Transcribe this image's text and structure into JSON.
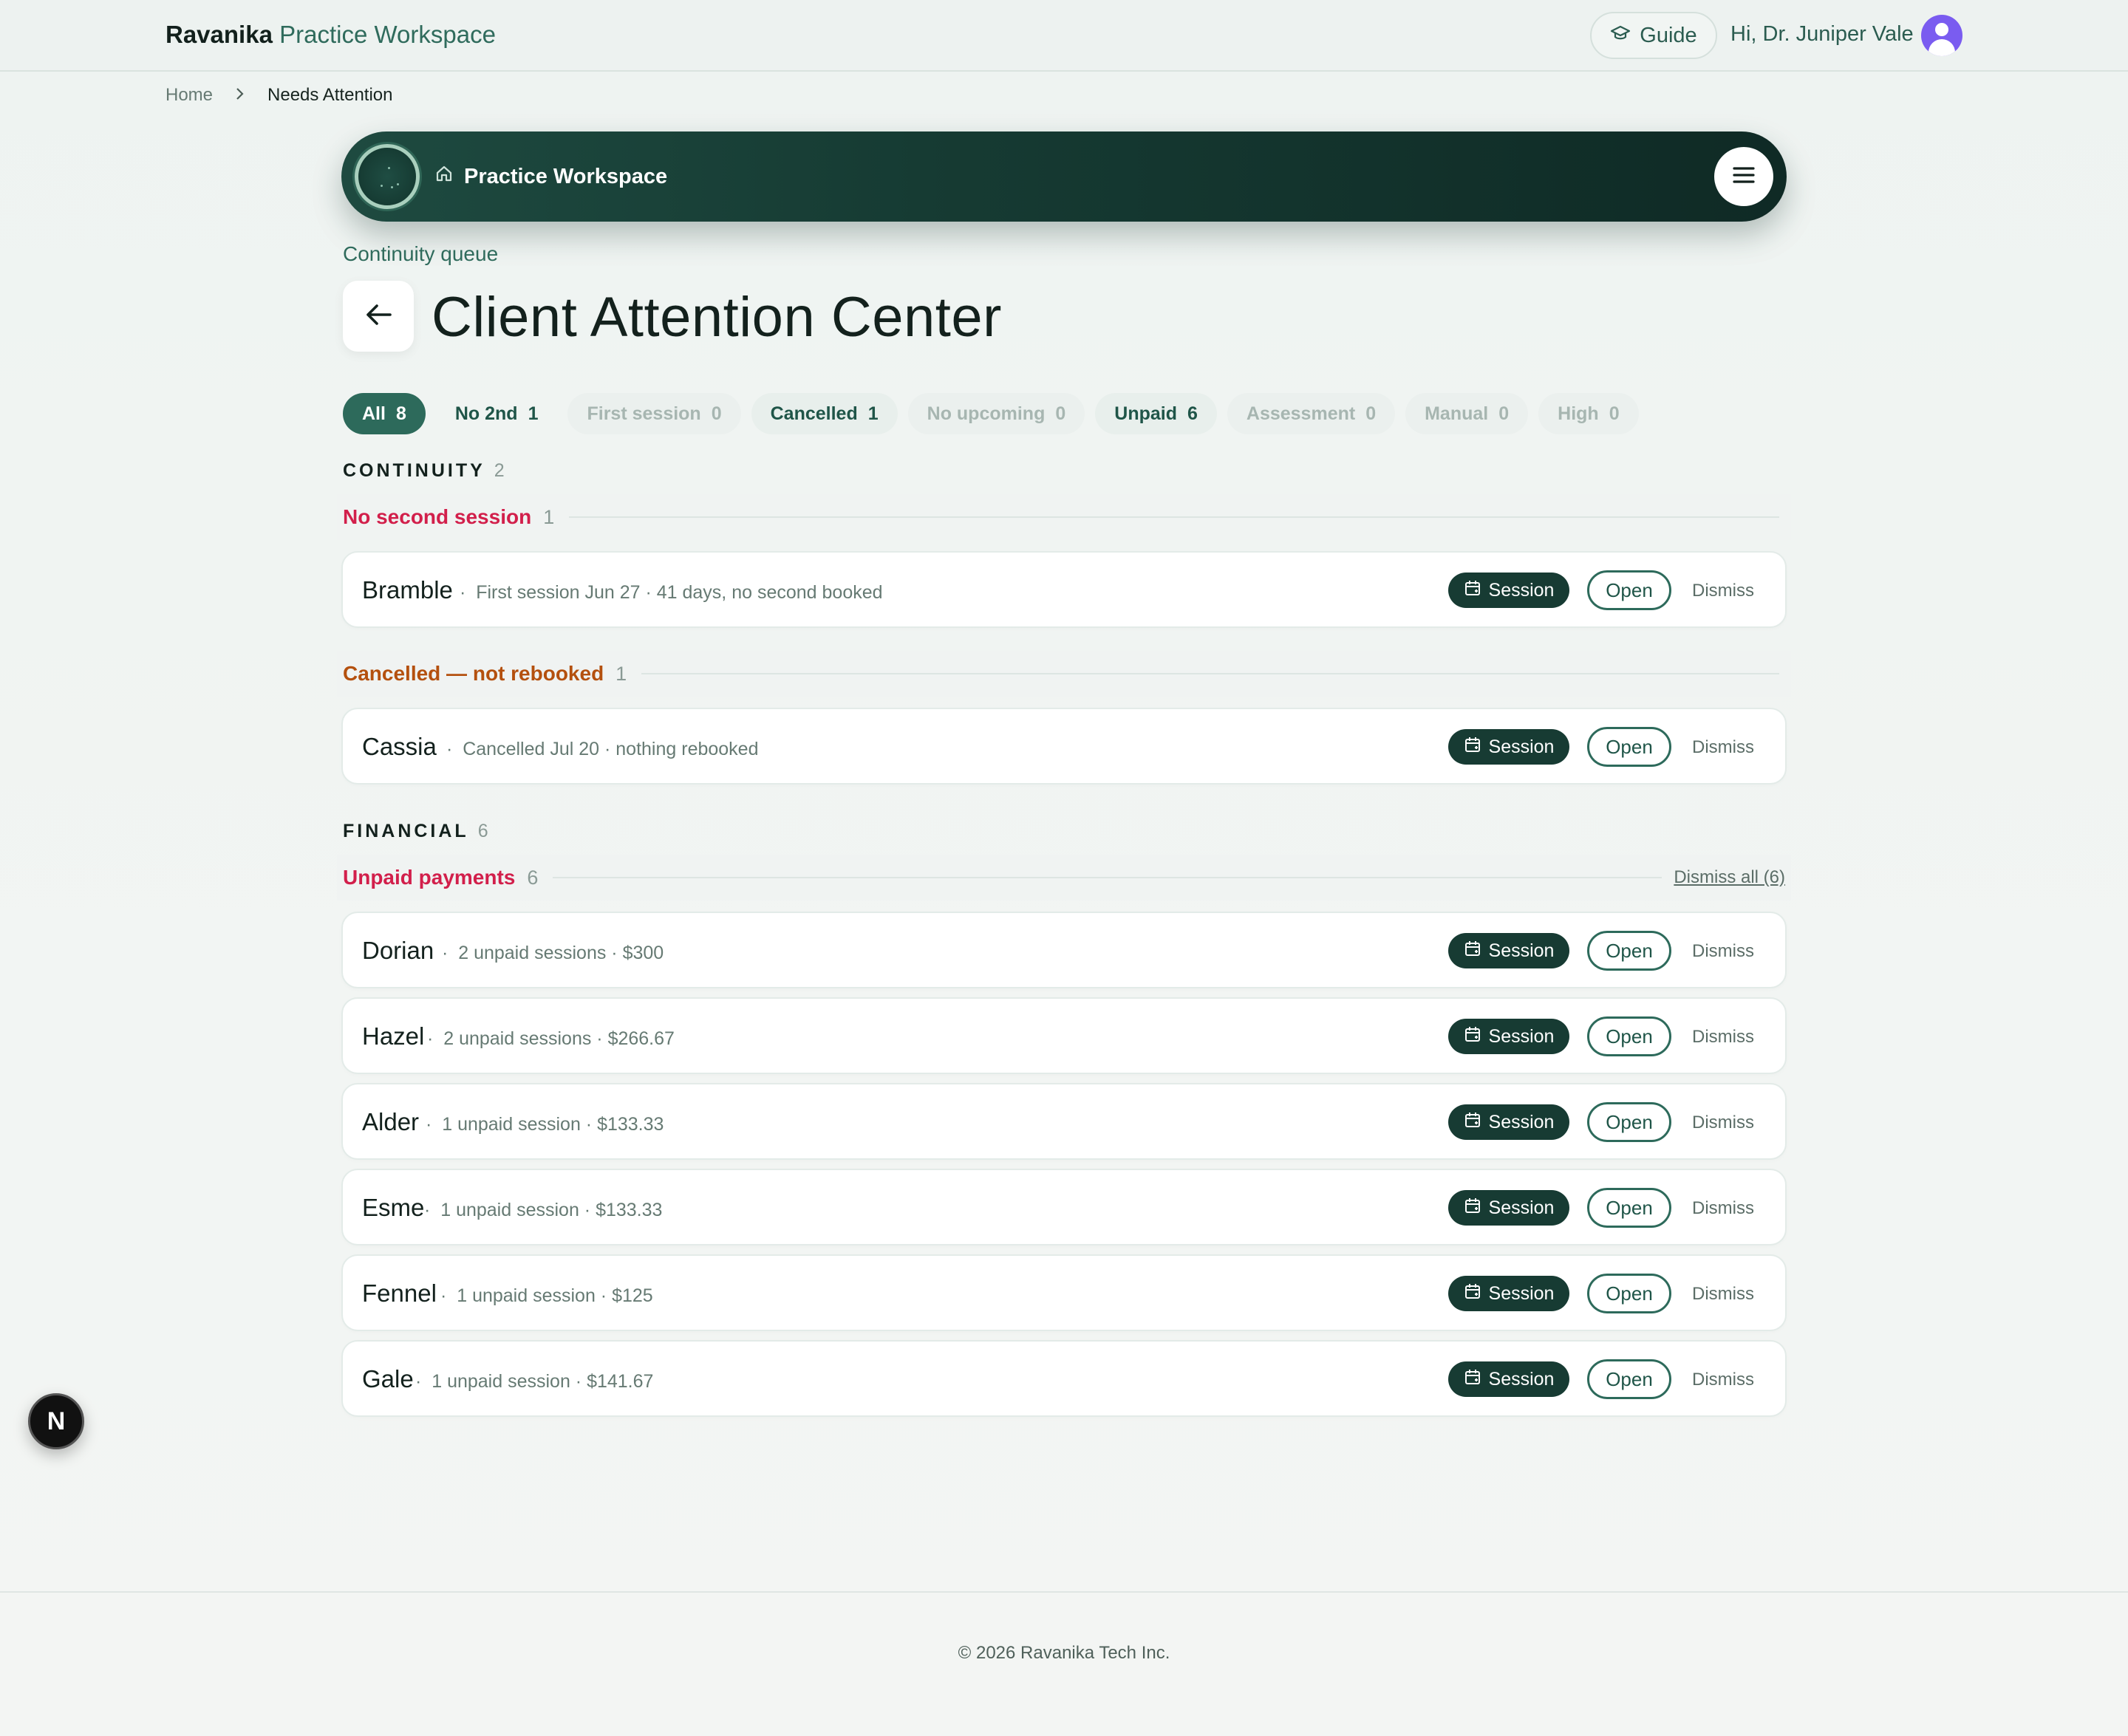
{
  "header": {
    "brand_name": "Ravanika",
    "brand_product": "Practice Workspace",
    "guide_label": "Guide",
    "greeting": "Hi, Dr. Juniper Vale"
  },
  "breadcrumb": {
    "home": "Home",
    "current": "Needs Attention"
  },
  "hero": {
    "title": "Practice Workspace"
  },
  "page": {
    "eyebrow": "Continuity queue",
    "title": "Client Attention Center"
  },
  "filters": [
    {
      "label": "All",
      "count": "8"
    },
    {
      "label": "No 2nd",
      "count": "1"
    },
    {
      "label": "First session",
      "count": "0"
    },
    {
      "label": "Cancelled",
      "count": "1"
    },
    {
      "label": "No upcoming",
      "count": "0"
    },
    {
      "label": "Unpaid",
      "count": "6"
    },
    {
      "label": "Assessment",
      "count": "0"
    },
    {
      "label": "Manual",
      "count": "0"
    },
    {
      "label": "High",
      "count": "0"
    }
  ],
  "sections": {
    "continuity": {
      "label": "CONTINUITY",
      "count": "2"
    },
    "financial": {
      "label": "FINANCIAL",
      "count": "6"
    }
  },
  "groups": {
    "no_second": {
      "title": "No second session",
      "count": "1"
    },
    "cancelled": {
      "title": "Cancelled — not rebooked",
      "count": "1"
    },
    "unpaid": {
      "title": "Unpaid payments",
      "count": "6",
      "dismiss_all": "Dismiss all (6)"
    }
  },
  "actions": {
    "session": "Session",
    "open": "Open",
    "dismiss": "Dismiss"
  },
  "rows": [
    {
      "name": "Bramble",
      "meta": "First session Jun 27 · 41 days, no second booked"
    },
    {
      "name": "Cassia",
      "meta": "Cancelled Jul 20 · nothing rebooked"
    },
    {
      "name": "Dorian",
      "meta": "2 unpaid sessions · $300"
    },
    {
      "name": "Hazel",
      "meta": "2 unpaid sessions · $266.67"
    },
    {
      "name": "Alder",
      "meta": "1 unpaid session · $133.33"
    },
    {
      "name": "Esme",
      "meta": "1 unpaid session · $133.33"
    },
    {
      "name": "Fennel",
      "meta": "1 unpaid session · $125"
    },
    {
      "name": "Gale",
      "meta": "1 unpaid session · $141.67"
    }
  ],
  "fab_label": "N",
  "footer": "© 2026 Ravanika Tech Inc.",
  "colors": {
    "accent": "#2d6a5b",
    "dark": "#173b33",
    "alert_red": "#d21f4b",
    "alert_orange": "#b4500e",
    "avatar": "#7a5cf0"
  }
}
